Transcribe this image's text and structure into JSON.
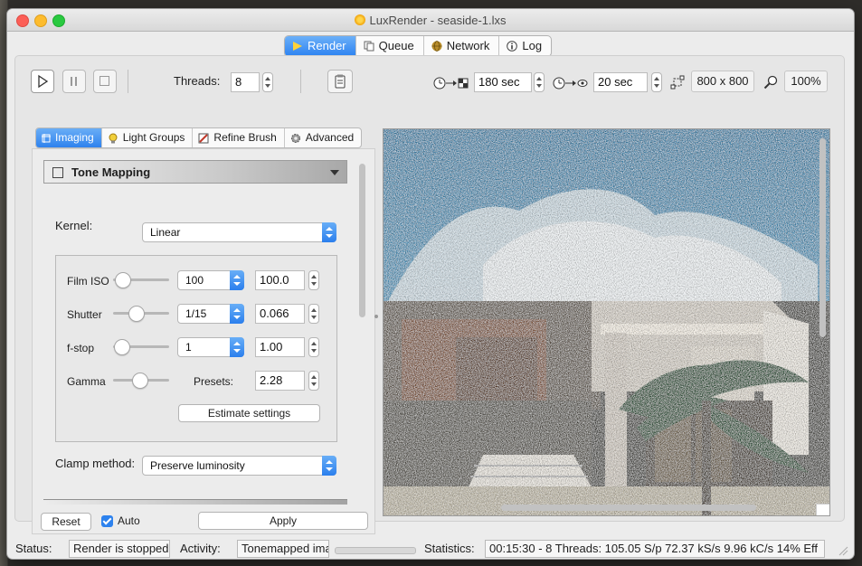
{
  "window": {
    "title": "LuxRender - seaside-1.lxs"
  },
  "main_tabs": [
    {
      "label": "Render"
    },
    {
      "label": "Queue"
    },
    {
      "label": "Network"
    },
    {
      "label": "Log"
    }
  ],
  "toolbar": {
    "threads_label": "Threads:",
    "threads_value": "8",
    "time_halt_value": "180 sec",
    "display_interval_value": "20 sec",
    "resolution": "800 x 800",
    "zoom": "100%"
  },
  "sub_tabs": [
    {
      "label": "Imaging"
    },
    {
      "label": "Light Groups"
    },
    {
      "label": "Refine Brush"
    },
    {
      "label": "Advanced"
    }
  ],
  "tone_mapping": {
    "section_title": "Tone Mapping",
    "kernel_label": "Kernel:",
    "kernel_value": "Linear",
    "film_iso_label": "Film ISO",
    "film_iso_preset": "100",
    "film_iso_value": "100.0",
    "shutter_label": "Shutter",
    "shutter_preset": "1/15",
    "shutter_value": "0.066",
    "fstop_label": "f-stop",
    "fstop_preset": "1",
    "fstop_value": "1.00",
    "gamma_label": "Gamma",
    "presets_label": "Presets:",
    "gamma_value": "2.28",
    "estimate_button": "Estimate settings",
    "clamp_label": "Clamp method:",
    "clamp_value": "Preserve luminosity"
  },
  "bottom_buttons": {
    "reset": "Reset",
    "auto": "Auto",
    "apply": "Apply"
  },
  "status_bar": {
    "status_label": "Status:",
    "status_value": "Render is stopped",
    "activity_label": "Activity:",
    "activity_value": "Tonemapped ima",
    "statistics_label": "Statistics:",
    "statistics_value": "00:15:30 - 8 Threads: 105.05 S/p 72.37 kS/s 9.96 kC/s 14% Eff"
  }
}
